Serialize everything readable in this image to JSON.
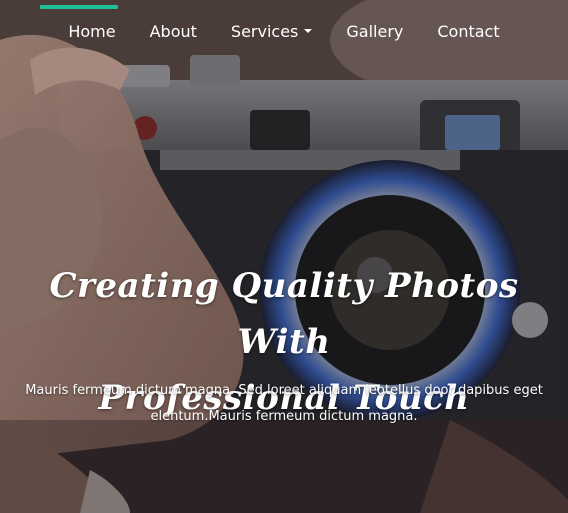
{
  "nav": {
    "items": [
      {
        "label": "Home"
      },
      {
        "label": "About"
      },
      {
        "label": "Services"
      },
      {
        "label": "Gallery"
      },
      {
        "label": "Contact"
      }
    ],
    "accent_color": "#1fbf9b"
  },
  "hero": {
    "headline_line1": "Creating Quality Photos With",
    "headline_line2": "Professional Touch",
    "description_line1": "Mauris fermeum dictum magna. Sed loreet aliquam leotellus door dapibus eget",
    "description_line2": "elentum.Mauris fermeum dictum magna.",
    "background": "camera-photo"
  }
}
